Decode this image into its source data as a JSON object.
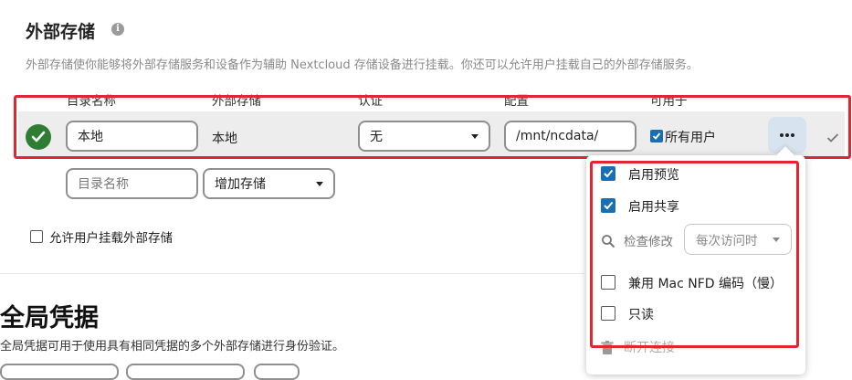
{
  "header": {
    "title": "外部存储",
    "info_icon": "info-icon",
    "description": "外部存储使你能够将外部存储服务和设备作为辅助 Nextcloud 存储设备进行挂载。你还可以允许用户挂载自己的外部存储服务。"
  },
  "table": {
    "columns": [
      "目录名称",
      "外部存储",
      "认证",
      "配置",
      "可用于"
    ]
  },
  "mount_row": {
    "status": "ok",
    "folder_name": "本地",
    "backend": "本地",
    "auth": "无",
    "config": "/mnt/ncdata/",
    "available_for_checked": true,
    "available_for": "所有用户"
  },
  "new_row": {
    "folder_placeholder": "目录名称",
    "add_storage": "增加存储"
  },
  "allow_user_mount": {
    "checked": false,
    "label": "允许用户挂载外部存储"
  },
  "global_credentials": {
    "title": "全局凭据",
    "description": "全局凭据可用于使用具有相同凭据的多个外部存储进行身份验证。"
  },
  "options_menu": {
    "enable_preview": {
      "checked": true,
      "label": "启用预览"
    },
    "enable_sharing": {
      "checked": true,
      "label": "启用共享"
    },
    "check_changes": {
      "label": "检查修改",
      "value": "每次访问时"
    },
    "mac_nfd": {
      "checked": false,
      "label": "兼用 Mac NFD 编码（慢）"
    },
    "readonly": {
      "checked": false,
      "label": "只读"
    },
    "disconnect": {
      "label": "断开连接"
    }
  },
  "colors": {
    "highlight": "#e0262e",
    "status_ok": "#2e7d32",
    "checkbox": "#1a6fb3",
    "row_bg": "#ededed"
  }
}
